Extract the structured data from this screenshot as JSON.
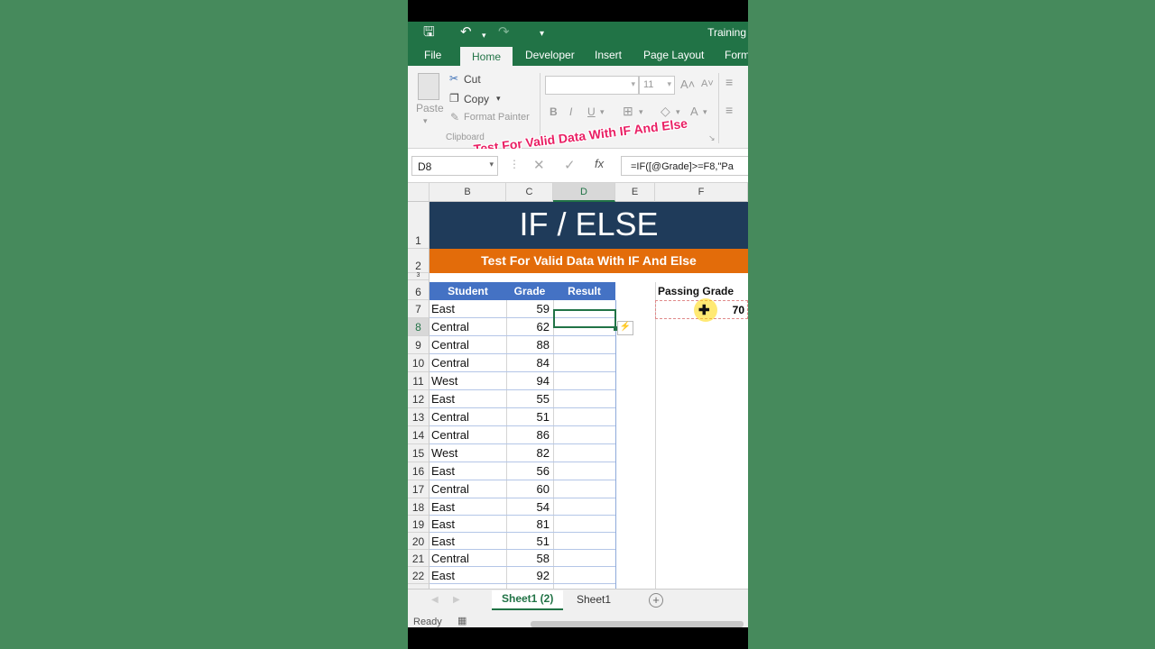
{
  "toolbar": {
    "save_icon": "save-icon",
    "undo_icon": "undo-icon",
    "redo_icon": "redo-icon",
    "window_title": "Training"
  },
  "tabs": [
    "File",
    "Home",
    "Developer",
    "Insert",
    "Page Layout",
    "Form"
  ],
  "active_tab": "Home",
  "clipboard": {
    "paste": "Paste",
    "cut": "Cut",
    "copy": "Copy",
    "format_painter": "Format Painter",
    "group_label": "Clipboard"
  },
  "font": {
    "size": "11",
    "bold": "B",
    "italic": "I",
    "underline": "U"
  },
  "overlay_caption": "Test For Valid Data With IF And Else",
  "formula_bar": {
    "name_box": "D8",
    "formula": "=IF([@Grade]>=F8,\"Pa"
  },
  "columns": [
    "B",
    "C",
    "D",
    "E",
    "F"
  ],
  "rows": [
    "1",
    "2",
    "3",
    "6",
    "7",
    "8",
    "9",
    "10",
    "11",
    "12",
    "13",
    "14",
    "15",
    "16",
    "17",
    "18",
    "19",
    "20",
    "21",
    "22"
  ],
  "banner": {
    "title": "IF / ELSE",
    "subtitle": "Test For Valid Data With IF And Else"
  },
  "table": {
    "headers": [
      "Student",
      "Grade",
      "Result"
    ],
    "rows": [
      {
        "student": "East",
        "grade": "59"
      },
      {
        "student": "Central",
        "grade": "62"
      },
      {
        "student": "Central",
        "grade": "88"
      },
      {
        "student": "Central",
        "grade": "84"
      },
      {
        "student": "West",
        "grade": "94"
      },
      {
        "student": "East",
        "grade": "55"
      },
      {
        "student": "Central",
        "grade": "51"
      },
      {
        "student": "Central",
        "grade": "86"
      },
      {
        "student": "West",
        "grade": "82"
      },
      {
        "student": "East",
        "grade": "56"
      },
      {
        "student": "Central",
        "grade": "60"
      },
      {
        "student": "East",
        "grade": "54"
      },
      {
        "student": "East",
        "grade": "81"
      },
      {
        "student": "East",
        "grade": "51"
      },
      {
        "student": "Central",
        "grade": "58"
      },
      {
        "student": "East",
        "grade": "92"
      }
    ]
  },
  "passing": {
    "label": "Passing Grade",
    "value": "70"
  },
  "sheets": [
    "Sheet1 (2)",
    "Sheet1"
  ],
  "status": "Ready",
  "colors": {
    "excel_green": "#217346",
    "banner_navy": "#1f3b5a",
    "banner_orange": "#e36c0a",
    "table_header": "#4472c4",
    "overlay_pink": "#e91e63"
  }
}
